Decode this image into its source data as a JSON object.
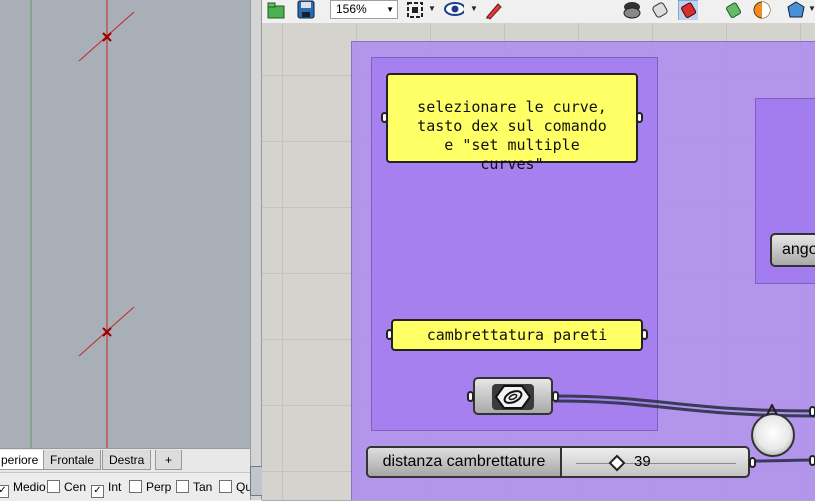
{
  "viewport_tabs": [
    "periore",
    "Frontale",
    "Destra",
    "+"
  ],
  "osnaps": [
    {
      "label": "Medio",
      "checked": true
    },
    {
      "label": "Cen",
      "checked": false
    },
    {
      "label": "Int",
      "checked": true
    },
    {
      "label": "Perp",
      "checked": false
    },
    {
      "label": "Tan",
      "checked": false
    },
    {
      "label": "Qu",
      "checked": false
    }
  ],
  "toolbar": {
    "zoom": "156%",
    "icons": [
      "open-file-icon",
      "save-icon",
      "zoom-extents-icon",
      "preview-eye-icon",
      "sketch-pen-icon",
      "preview-shaded-icon",
      "preview-wire-icon",
      "preview-selected-icon",
      "bake-icon",
      "display-icon",
      "solid-icon"
    ]
  },
  "canvas": {
    "note_panel": "selezionare le curve,\ntasto dex sul comando\ne \"set multiple\ncurves\"",
    "title_panel": "cambrettatura pareti",
    "slider": {
      "label": "distanza cambrettature",
      "value": "39",
      "fraction": 0.25
    },
    "ango_label": "ango"
  },
  "colors": {
    "group": "#af8cf0",
    "panel": "#ffff66",
    "wire": "#3a3a5a",
    "viewport": "#a9afb6",
    "curve": "#c0282b"
  }
}
